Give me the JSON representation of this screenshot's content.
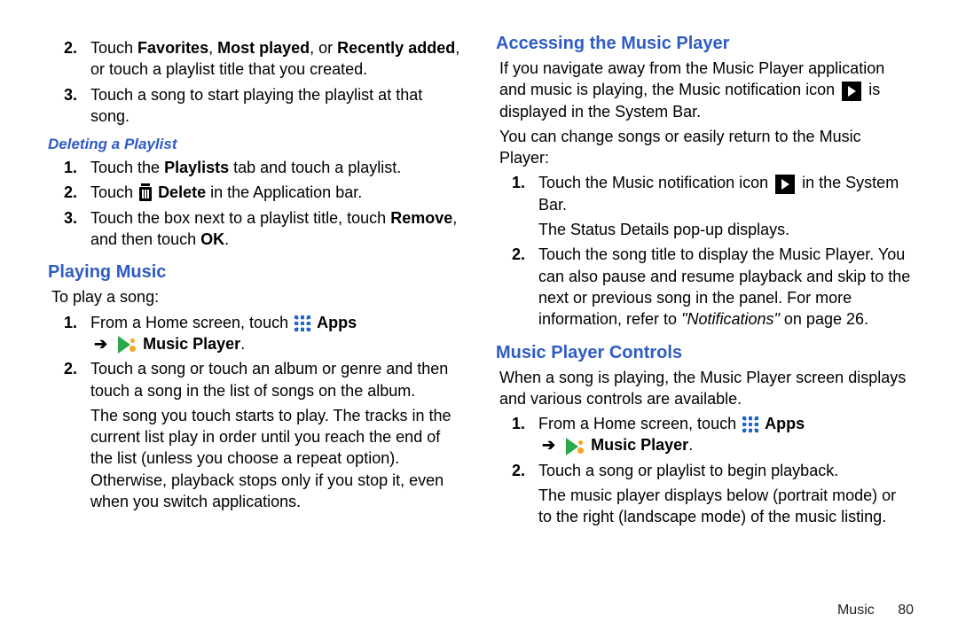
{
  "left": {
    "item2_a": "Touch ",
    "item2_b": "Favorites",
    "item2_c": ", ",
    "item2_d": "Most played",
    "item2_e": ", or ",
    "item2_f": "Recently added",
    "item2_g": ", or touch a playlist title that you created.",
    "item3": "Touch a song to start playing the playlist at that song.",
    "h_deleting": "Deleting a Playlist",
    "d1_a": "Touch the ",
    "d1_b": "Playlists",
    "d1_c": " tab and touch a playlist.",
    "d2_a": "Touch ",
    "d2_b": "Delete",
    "d2_c": " in the Application bar.",
    "d3_a": "Touch the box next to a playlist title, touch ",
    "d3_b": "Remove",
    "d3_c": ", and then touch ",
    "d3_d": "OK",
    "d3_e": ".",
    "h_playing": "Playing Music",
    "p_intro": "To play a song:",
    "p1_a": "From a Home screen, touch ",
    "p1_apps": "Apps",
    "p1_arrow": "➔",
    "p1_music": "Music Player",
    "p1_end": ".",
    "p2": "Touch a song or touch an album or genre and then touch a song in the list of songs on the album.",
    "p2b": "The song you touch starts to play. The tracks in the current list play in order until you reach the end of the list (unless you choose a repeat option). Otherwise, playback stops only if you stop it, even when you switch applications."
  },
  "right": {
    "h_access": "Accessing the Music Player",
    "a_p1_a": "If you navigate away from the Music Player application and music is playing, the Music notification icon ",
    "a_p1_b": " is displayed in the System Bar.",
    "a_p2": "You can change songs or easily return to the Music Player:",
    "a1_a": "Touch the Music notification icon ",
    "a1_b": " in the System Bar.",
    "a1_c": "The Status Details pop-up displays.",
    "a2_a": "Touch the song title to display the Music Player. You can also pause and resume playback and skip to the next or previous song in the panel. For more information, refer to ",
    "a2_b": "\"Notifications\"",
    "a2_c": " on page 26.",
    "h_controls": "Music Player Controls",
    "c_p1": "When a song is playing, the Music Player screen displays and various controls are available.",
    "c1_a": "From a Home screen, touch ",
    "c1_apps": "Apps",
    "c1_arrow": "➔",
    "c1_music": "Music Player",
    "c1_end": ".",
    "c2": "Touch a song or playlist to begin playback.",
    "c2b": "The music player displays below (portrait mode) or to the right (landscape mode) of the music listing."
  },
  "footer": {
    "section": "Music",
    "page": "80"
  },
  "num": {
    "n1": "1.",
    "n2": "2.",
    "n3": "3."
  }
}
